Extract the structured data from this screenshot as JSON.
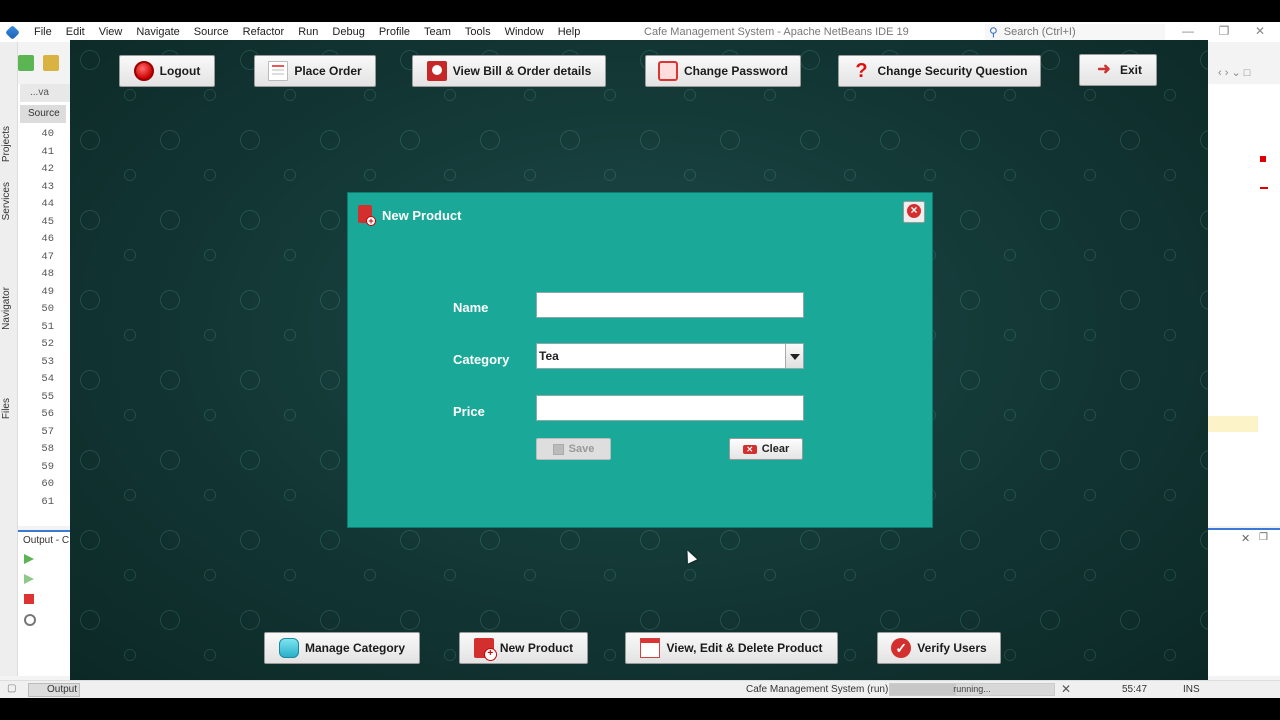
{
  "ide": {
    "menu": [
      "File",
      "Edit",
      "View",
      "Navigate",
      "Source",
      "Refactor",
      "Run",
      "Debug",
      "Profile",
      "Team",
      "Tools",
      "Window",
      "Help"
    ],
    "title": "Cafe Management System - Apache NetBeans IDE 19",
    "search_placeholder": "Search (Ctrl+I)",
    "side_tabs": [
      "Projects",
      "Services",
      "Navigator",
      "Files"
    ],
    "editor_tab": "...va",
    "source_button": "Source",
    "line_numbers": [
      "40",
      "41",
      "42",
      "43",
      "44",
      "45",
      "46",
      "47",
      "48",
      "49",
      "50",
      "51",
      "52",
      "53",
      "54",
      "55",
      "56",
      "57",
      "58",
      "59",
      "60",
      "61"
    ],
    "output_title": "Output - C",
    "status": {
      "output_tab": "Output",
      "run_label": "Cafe Management System (run)",
      "progress_text": "running...",
      "progress_fraction": 0.4,
      "position": "55:47",
      "mode": "INS"
    }
  },
  "app": {
    "top_buttons": {
      "logout": "Logout",
      "place_order": "Place Order",
      "view_bill": "View Bill & Order details",
      "change_password": "Change Password",
      "change_security": "Change Security Question",
      "exit": "Exit"
    },
    "bottom_buttons": {
      "manage_category": "Manage Category",
      "new_product": "New Product",
      "view_edit_delete": "View, Edit & Delete Product",
      "verify_users": "Verify Users"
    },
    "dialog": {
      "title": "New Product",
      "name_label": "Name",
      "name_value": "",
      "category_label": "Category",
      "category_value": "Tea",
      "price_label": "Price",
      "price_value": "",
      "save_label": "Save",
      "clear_label": "Clear"
    }
  },
  "colors": {
    "dialog_bg": "#1aa898",
    "app_bg": "#123634",
    "accent_blue": "#3c78d8"
  }
}
